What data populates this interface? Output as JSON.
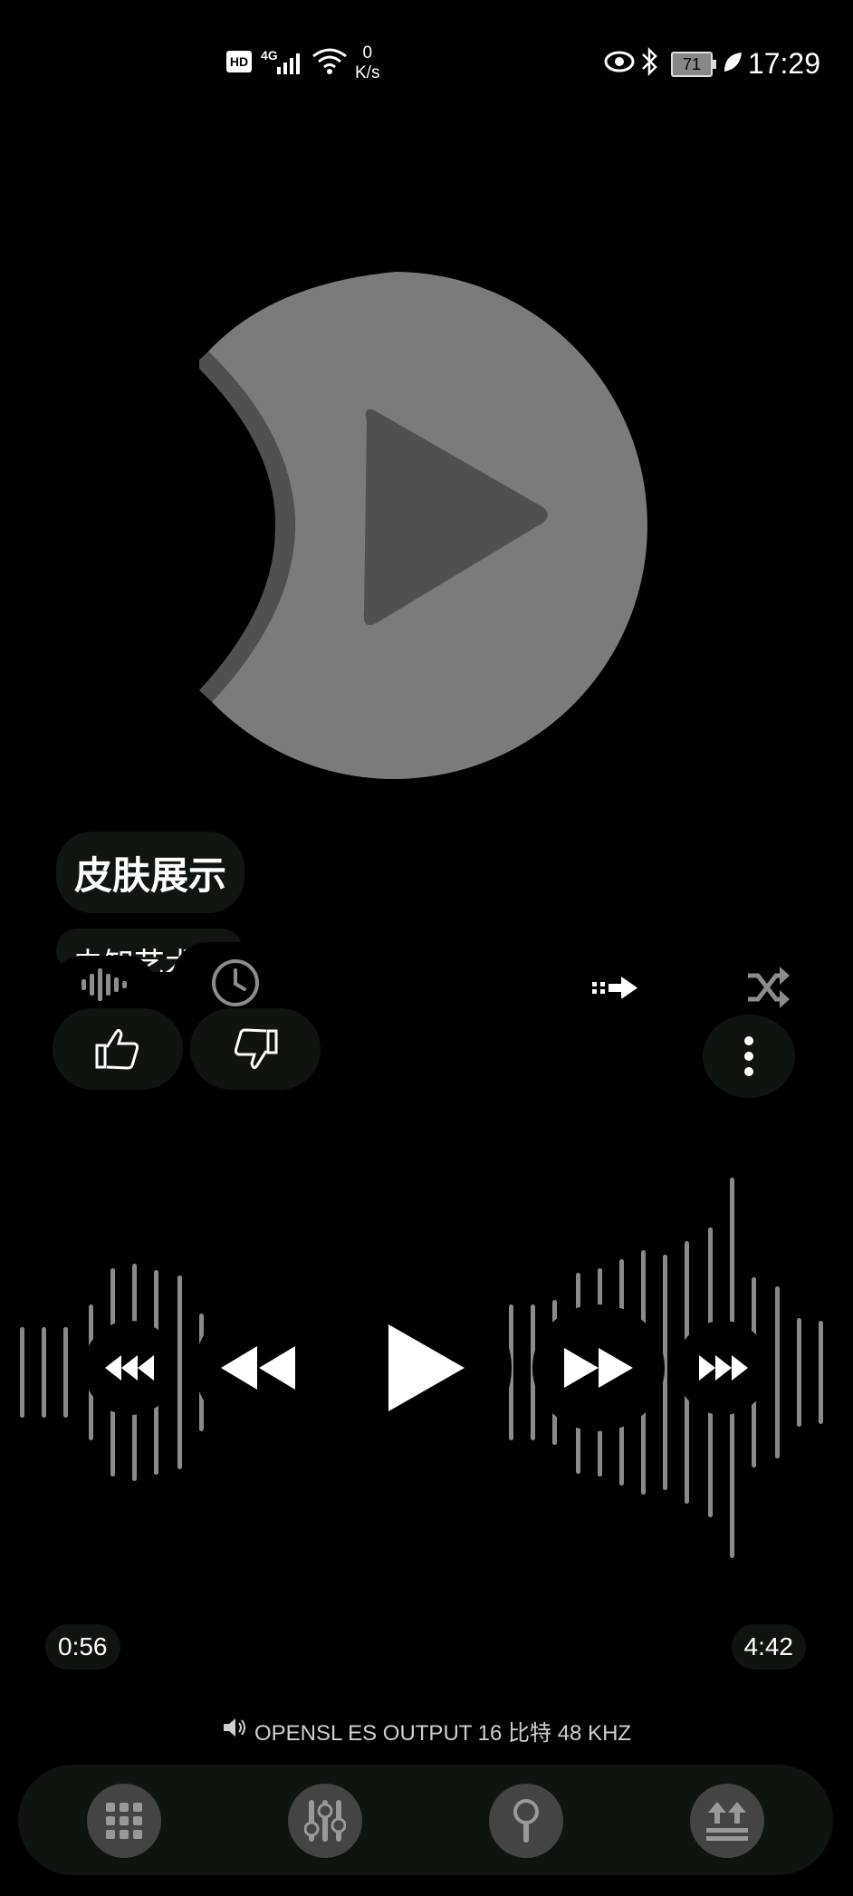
{
  "status_bar": {
    "network_badge": "HD",
    "network_type": "4G",
    "speed_value": "0",
    "speed_unit": "K/s",
    "battery": "71",
    "time": "17:29"
  },
  "track": {
    "title": "皮肤展示",
    "artist": "未知艺术家"
  },
  "times": {
    "elapsed": "0:56",
    "total": "4:42"
  },
  "output_info": "OPENSL ES OUTPUT  16 比特  48 KHZ",
  "icons": {
    "album_art": "play-icon",
    "visualizer": "waveform-icon",
    "timer": "clock-icon",
    "repeat": "next-arrow-icon",
    "shuffle": "shuffle-icon",
    "like": "thumbs-up-icon",
    "dislike": "thumbs-down-icon",
    "more": "more-vertical-icon",
    "nav": [
      "grid-icon",
      "equalizer-icon",
      "search-icon",
      "upload-icon"
    ]
  },
  "colors": {
    "background": "#000000",
    "pill": "#0f1411",
    "art_gray": "#7c7b7c",
    "art_dark": "#505050"
  }
}
